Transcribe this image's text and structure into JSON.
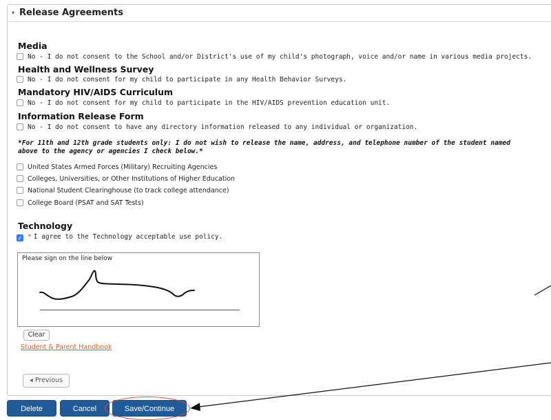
{
  "panel": {
    "title": "Release Agreements",
    "caret": "▾"
  },
  "sections": {
    "media": {
      "heading": "Media",
      "option": "No - I do not consent to the School and/or District's use of my child's photograph, voice and/or name in various media projects."
    },
    "health": {
      "heading": "Health and Wellness Survey",
      "option": "No - I do not consent for my child to participate in any Health Behavior Surveys."
    },
    "hiv": {
      "heading": "Mandatory HIV/AIDS Curriculum",
      "option": "No - I do not consent for my child to participate in the HIV/AIDS prevention education unit."
    },
    "info": {
      "heading": "Information Release Form",
      "option": "No - I do not consent to have any directory information released to any individual or organization."
    }
  },
  "grade_note": "*For 11th and 12th grade students only: I do not wish to release the name, address, and telephone number of the student named above to the agency or agencies I check below.*",
  "release_agencies": [
    "United States Armed Forces (Military) Recruiting Agencies",
    "Colleges, Universities, or Other Institutions of Higher Education",
    "National Student Clearinghouse (to track college attendance)",
    "College Board (PSAT and SAT Tests)"
  ],
  "technology": {
    "heading": "Technology",
    "required_mark": "*",
    "option": "I agree to the Technology acceptable use policy.",
    "checked": true
  },
  "signature": {
    "label": "Please sign on the line below"
  },
  "buttons": {
    "clear": "Clear",
    "previous": "Previous",
    "previous_icon": "◂",
    "delete": "Delete",
    "cancel": "Cancel",
    "save_continue": "Save/Continue"
  },
  "links": {
    "handbook": "Student & Parent Handbook"
  },
  "colors": {
    "primary_button": "#1f5a99",
    "link": "#d9622b",
    "annotation": "#e04a3f",
    "checkbox_checked": "#3b82f6"
  }
}
